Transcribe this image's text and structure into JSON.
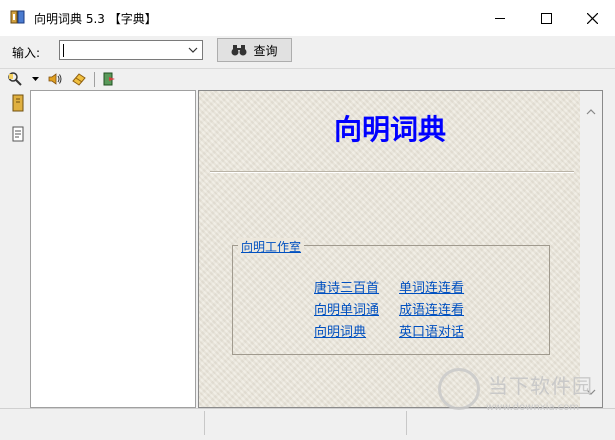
{
  "window": {
    "title": "向明词典 5.3 【字典】",
    "minimize_symbol": "—",
    "maximize_symbol": "☐",
    "close_symbol": "✕"
  },
  "search": {
    "label": "输入:",
    "value": "",
    "query_label": "查询"
  },
  "content": {
    "title": "向明词典",
    "group_label": "向明工作室",
    "links": [
      {
        "label": "唐诗三百首"
      },
      {
        "label": "单词连连看"
      },
      {
        "label": "向明单词通"
      },
      {
        "label": "成语连连看"
      },
      {
        "label": "向明词典"
      },
      {
        "label": "英口语对话"
      }
    ]
  },
  "watermark": {
    "text": "当下软件园",
    "url": "www.downxia.com"
  },
  "colors": {
    "title_blue": "#0000ff",
    "link_blue": "#0050c0",
    "paper": "#ece7dc"
  }
}
